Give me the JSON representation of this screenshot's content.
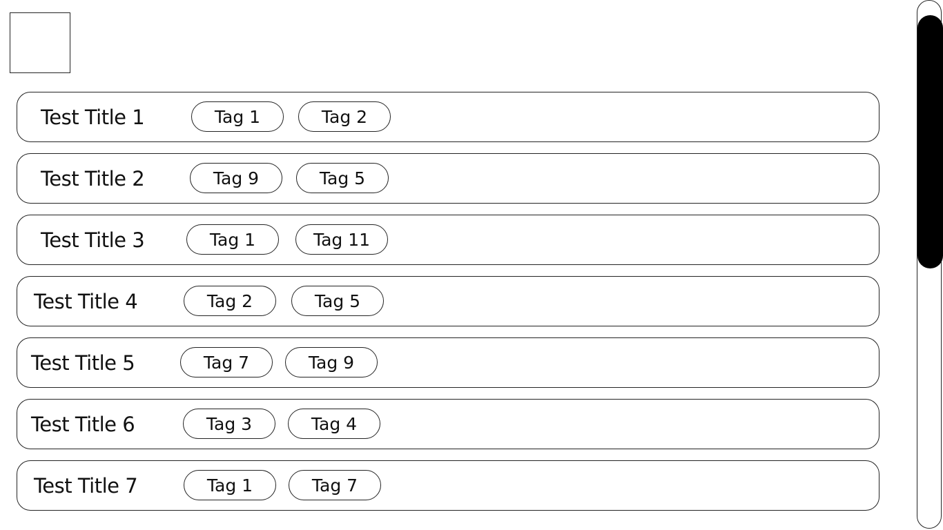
{
  "rows": [
    {
      "title": "Test Title 1",
      "tags": [
        "Tag 1",
        "Tag 2"
      ]
    },
    {
      "title": "Test Title 2",
      "tags": [
        "Tag 9",
        "Tag 5"
      ]
    },
    {
      "title": "Test Title 3",
      "tags": [
        "Tag 1",
        "Tag 11"
      ]
    },
    {
      "title": "Test Title 4",
      "tags": [
        "Tag 2",
        "Tag 5"
      ]
    },
    {
      "title": "Test Title 5",
      "tags": [
        "Tag 7",
        "Tag 9"
      ]
    },
    {
      "title": "Test Title 6",
      "tags": [
        "Tag 3",
        "Tag 4"
      ]
    },
    {
      "title": "Test Title 7",
      "tags": [
        "Tag 1",
        "Tag 7"
      ]
    }
  ],
  "scrollbar": {
    "position": 0.0
  }
}
